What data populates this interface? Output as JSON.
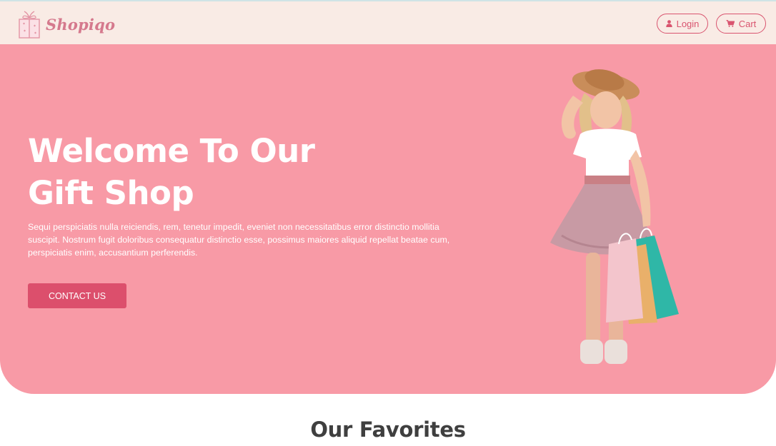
{
  "navbar": {
    "brand_name": "Shopiqo",
    "brand_icon": "gift-box-icon",
    "login_label": "Login",
    "login_icon": "user-icon",
    "cart_label": "Cart",
    "cart_icon": "cart-icon"
  },
  "hero": {
    "title_line1": "Welcome To Our",
    "title_line2": "Gift Shop",
    "description": "Sequi perspiciatis nulla reiciendis, rem, tenetur impedit, eveniet non necessitatibus error distinctio mollitia suscipit. Nostrum fugit doloribus consequatur distinctio esse, possimus maiores aliquid repellat beatae cum, perspiciatis enim, accusantium perferendis.",
    "cta_label": "CONTACT US",
    "image": "girl-with-shopping-bags"
  },
  "favorites": {
    "title": "Our Favorites"
  },
  "colors": {
    "hero_bg": "#f89aa6",
    "navbar_bg": "#f9ebe5",
    "accent": "#dc4f6c",
    "brand": "#d5798d"
  }
}
